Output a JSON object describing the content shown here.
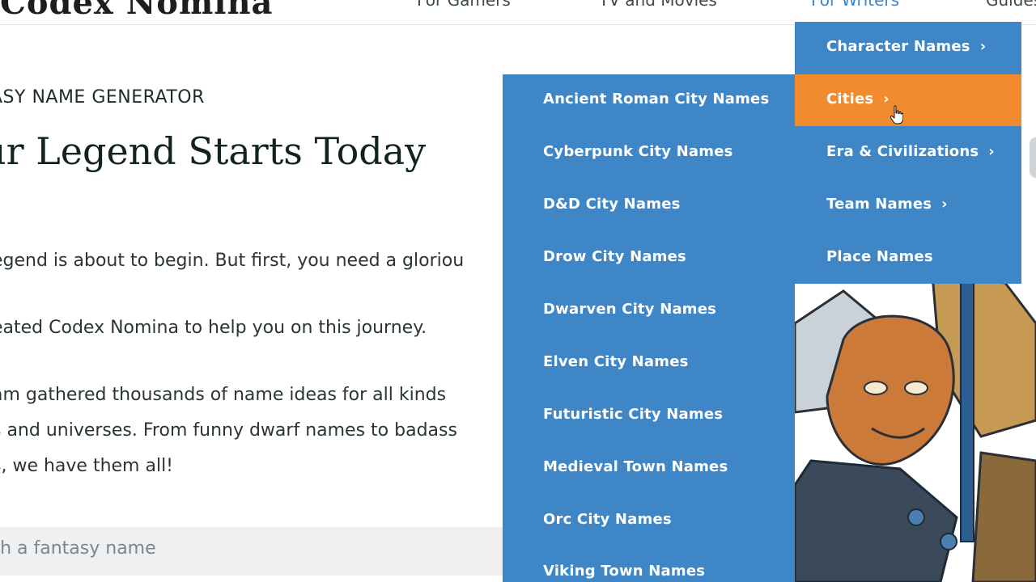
{
  "header": {
    "logo": "Codex Nomina",
    "nav": [
      {
        "label": "For Gamers"
      },
      {
        "label": "TV and Movies"
      },
      {
        "label": "For Writers"
      },
      {
        "label": "Guides"
      }
    ]
  },
  "hero": {
    "kicker": "asy name generator",
    "title": "ur Legend Starts Today",
    "paragraphs": [
      "egend is about to begin. But first, you need a gloriou",
      "eated Codex Nomina to help you on this journey.",
      "am gathered thousands of name ideas for all kinds",
      "s and universes. From funny dwarf names to badass",
      "s, we have them all!"
    ]
  },
  "search": {
    "placeholder": "ch a fantasy name"
  },
  "menu": {
    "primary": [
      {
        "label": "Character Names",
        "has_submenu": true
      },
      {
        "label": "Cities",
        "has_submenu": true,
        "active": true
      },
      {
        "label": "Era & Civilizations",
        "has_submenu": true
      },
      {
        "label": "Team Names",
        "has_submenu": true
      },
      {
        "label": "Place Names",
        "has_submenu": false
      }
    ],
    "cities_submenu": [
      {
        "label": "Ancient Roman City Names"
      },
      {
        "label": "Cyberpunk City Names"
      },
      {
        "label": "D&D City Names"
      },
      {
        "label": "Drow City Names"
      },
      {
        "label": "Dwarven City Names"
      },
      {
        "label": "Elven City Names"
      },
      {
        "label": "Futuristic City Names"
      },
      {
        "label": "Medieval Town Names"
      },
      {
        "label": "Orc City Names"
      },
      {
        "label": "Viking Town Names"
      }
    ],
    "chevron": "›"
  },
  "colors": {
    "menu_blue": "#3f86c6",
    "menu_active": "#f28a2e",
    "nav_active": "#3f86c6"
  }
}
